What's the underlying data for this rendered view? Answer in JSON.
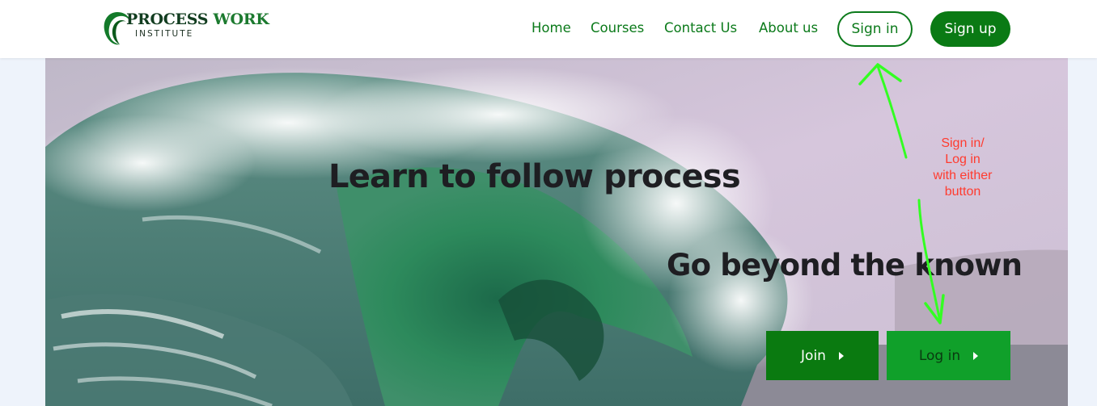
{
  "logo": {
    "name_part1": "PROCESS",
    "name_part2": "WORK",
    "subtitle": "INSTITUTE"
  },
  "nav": {
    "home": "Home",
    "courses": "Courses",
    "contact": "Contact Us",
    "about": "About us",
    "sign_in": "Sign in",
    "sign_up": "Sign up"
  },
  "hero": {
    "headline": "Learn to follow process",
    "subheadline": "Go beyond the known",
    "join_label": "Join",
    "login_label": "Log in"
  },
  "annotation": {
    "lines": [
      "Sign in/",
      "Log in",
      "with either",
      "button"
    ]
  },
  "colors": {
    "brand_green": "#0a7a14",
    "login_green": "#10a02a",
    "annotation_red": "#ff3b2f",
    "annotation_arrow": "#33ff22"
  }
}
